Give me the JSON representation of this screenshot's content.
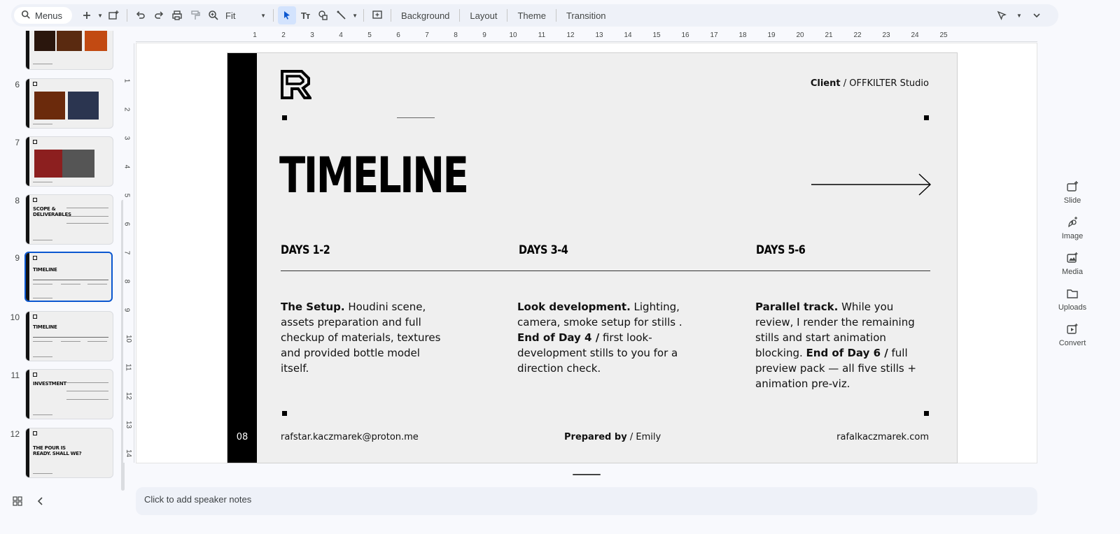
{
  "toolbar": {
    "menus_label": "Menus",
    "zoom_value": "Fit",
    "background_label": "Background",
    "layout_label": "Layout",
    "theme_label": "Theme",
    "transition_label": "Transition",
    "icons": [
      "search-icon",
      "plus-icon",
      "new-slide-icon",
      "undo-icon",
      "redo-icon",
      "print-icon",
      "paint-format-icon",
      "zoom-icon",
      "select-icon",
      "text-icon",
      "shape-icon",
      "line-icon",
      "comment-icon",
      "cursor-mode-icon"
    ]
  },
  "filmstrip": {
    "slides": [
      {
        "number": "",
        "title": ""
      },
      {
        "number": "6",
        "title": ""
      },
      {
        "number": "7",
        "title": ""
      },
      {
        "number": "8",
        "title": "SCOPE & DELIVERABLES"
      },
      {
        "number": "9",
        "title": "TIMELINE"
      },
      {
        "number": "10",
        "title": "TIMELINE"
      },
      {
        "number": "11",
        "title": "INVESTMENT"
      },
      {
        "number": "12",
        "title": "THE POUR IS READY. SHALL WE?"
      }
    ],
    "selected": "9"
  },
  "ruler": {
    "top": [
      "1",
      "2",
      "3",
      "4",
      "5",
      "6",
      "7",
      "8",
      "9",
      "10",
      "11",
      "12",
      "13",
      "14",
      "15",
      "16",
      "17",
      "18",
      "19",
      "20",
      "21",
      "22",
      "23",
      "24",
      "25"
    ],
    "left": [
      "1",
      "2",
      "3",
      "4",
      "5",
      "6",
      "7",
      "8",
      "9",
      "10",
      "11",
      "12",
      "13",
      "14"
    ]
  },
  "slide": {
    "client_label": "Client",
    "client_sep": "/",
    "client_name": "OFFKILTER Studio",
    "title": "TIMELINE",
    "days": [
      {
        "head": "DAYS 1-2",
        "bold1": "The Setup.",
        "text1": " Houdini scene, assets preparation and full checkup of materials, textures and provided bottle model itself.",
        "bold2": "",
        "text2": ""
      },
      {
        "head": "DAYS 3-4",
        "bold1": "Look development.",
        "text1": " Lighting, camera, smoke setup for stills . ",
        "bold2": "End of Day 4 /",
        "text2": " first look-development stills to you for a direction check."
      },
      {
        "head": "DAYS 5-6",
        "bold1": "Parallel track.",
        "text1": " While you review, I render the remaining stills and start animation blocking. ",
        "bold2": "End of Day 6 /",
        "text2": " full preview pack — all five stills + animation pre-viz."
      }
    ],
    "page_number": "08",
    "email": "rafstar.kaczmarek@proton.me",
    "prepared_label": "Prepared by",
    "prepared_sep": "/",
    "prepared_name": "Emily",
    "website": "rafalkaczmarek.com"
  },
  "side_panel": {
    "items": [
      "Slide",
      "Image",
      "Media",
      "Uploads",
      "Convert"
    ]
  },
  "notes": {
    "placeholder": "Click to add speaker notes"
  }
}
